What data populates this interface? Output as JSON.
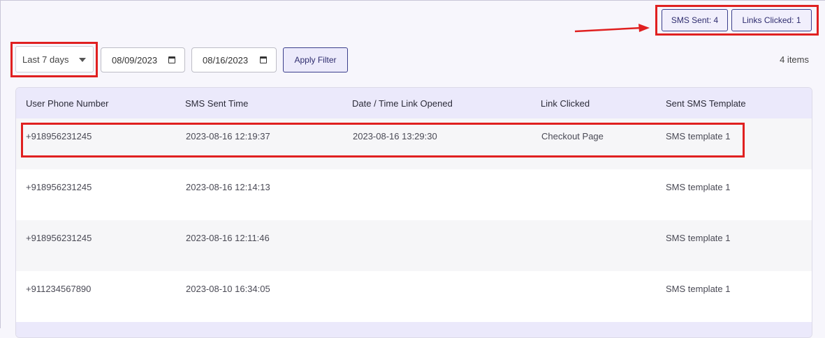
{
  "stats": {
    "sms_sent": "SMS Sent: 4",
    "links_clicked": "Links Clicked: 1"
  },
  "filters": {
    "range_select": "Last 7 days",
    "start_date": "08/09/2023",
    "end_date": "08/16/2023",
    "apply_label": "Apply Filter",
    "items_count": "4 items"
  },
  "table": {
    "columns": [
      "User Phone Number",
      "SMS Sent Time",
      "Date / Time Link Opened",
      "Link Clicked",
      "Sent SMS Template"
    ],
    "rows": [
      {
        "phone": "+918956231245",
        "sent_time": "2023-08-16 12:19:37",
        "opened": "2023-08-16 13:29:30",
        "link": "Checkout Page",
        "template": "SMS template 1"
      },
      {
        "phone": "+918956231245",
        "sent_time": "2023-08-16 12:14:13",
        "opened": "",
        "link": "",
        "template": "SMS template 1"
      },
      {
        "phone": "+918956231245",
        "sent_time": "2023-08-16 12:11:46",
        "opened": "",
        "link": "",
        "template": "SMS template 1"
      },
      {
        "phone": "+911234567890",
        "sent_time": "2023-08-10 16:34:05",
        "opened": "",
        "link": "",
        "template": "SMS template 1"
      }
    ]
  },
  "colors": {
    "accent": "#3b3f8c",
    "header_bg": "#ebe9fb",
    "highlight": "#e02020"
  }
}
